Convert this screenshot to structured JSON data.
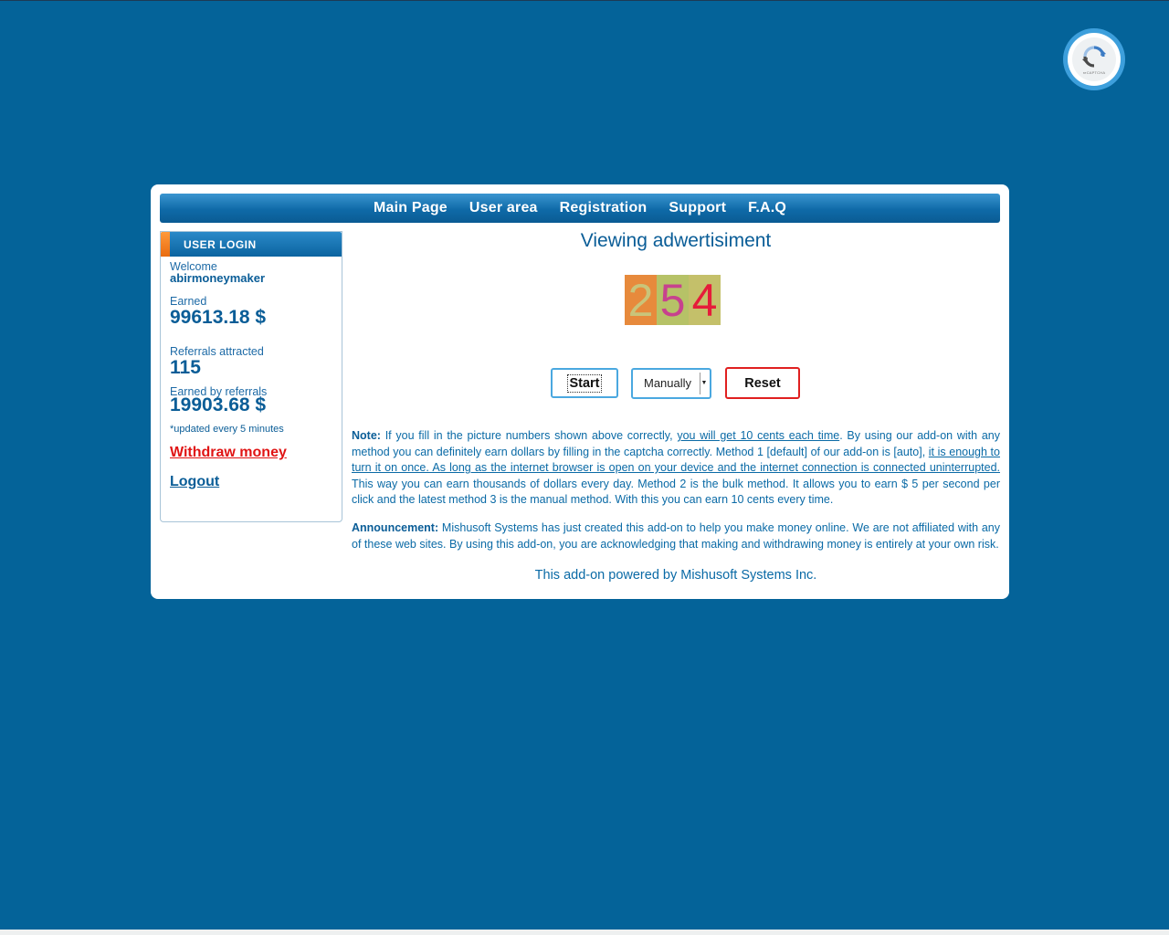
{
  "nav": {
    "items": [
      "Main Page",
      "User area",
      "Registration",
      "Support",
      "F.A.Q"
    ]
  },
  "login": {
    "title": "USER LOGIN",
    "welcome_label": "Welcome",
    "username": "abirmoneymaker",
    "earned_label": "Earned",
    "earned_value": "99613.18 $",
    "referrals_label": "Referrals attracted",
    "referrals_value": "115",
    "ref_earned_label": "Earned by referrals",
    "ref_earned_value": "19903.68 $",
    "update_note": "*updated every 5 minutes",
    "withdraw_label": "Withdraw money",
    "logout_label": "Logout"
  },
  "main": {
    "title": "Viewing adwertisiment",
    "captcha": {
      "digits": [
        "2",
        "5",
        "4"
      ],
      "colors": [
        {
          "bg": "#e78a3c",
          "fg": "#c9c47a"
        },
        {
          "bg": "#b6c267",
          "fg": "#c7428e"
        },
        {
          "bg": "#c4c06a",
          "fg": "#e51c3a"
        }
      ]
    },
    "start_label": "Start",
    "mode_value": "Manually",
    "reset_label": "Reset",
    "note": {
      "label": "Note:",
      "t1": " If you fill in the picture numbers shown above correctly, ",
      "u1": "you will get 10 cents each time",
      "t2": ". By using our add-on with any method you can definitely earn dollars by filling in the captcha correctly. Method 1 [default] of our add-on is [auto], ",
      "u2": "it is enough to turn it on once. As long as the internet browser is open on your device and the internet connection is connected uninterrupted.",
      "t3": " This way you can earn thousands of dollars every day. Method 2 is the bulk method. It allows you to earn $ 5 per second per click and the latest method 3 is the manual method. With this you can earn 10 cents every time."
    },
    "announcement": {
      "label": "Announcement:",
      "text": " Mishusoft Systems has just created this add-on to help you make money online. We are not affiliated with any of these web sites. By using this add-on, you are acknowledging that making and withdrawing money is entirely at your own risk."
    },
    "powered": "This add-on powered by Mishusoft Systems Inc."
  },
  "recaptcha": {
    "icon": "recaptcha-icon",
    "label": "reCAPTCHA",
    "colors": {
      "ring": "#3d9fdc",
      "arrow": "#3b7bc4"
    }
  },
  "colors": {
    "background": "#046399",
    "text": "#0a5d97",
    "withdraw": "#e01414",
    "start_border": "#4aa8e0",
    "reset_border": "#e02020"
  }
}
